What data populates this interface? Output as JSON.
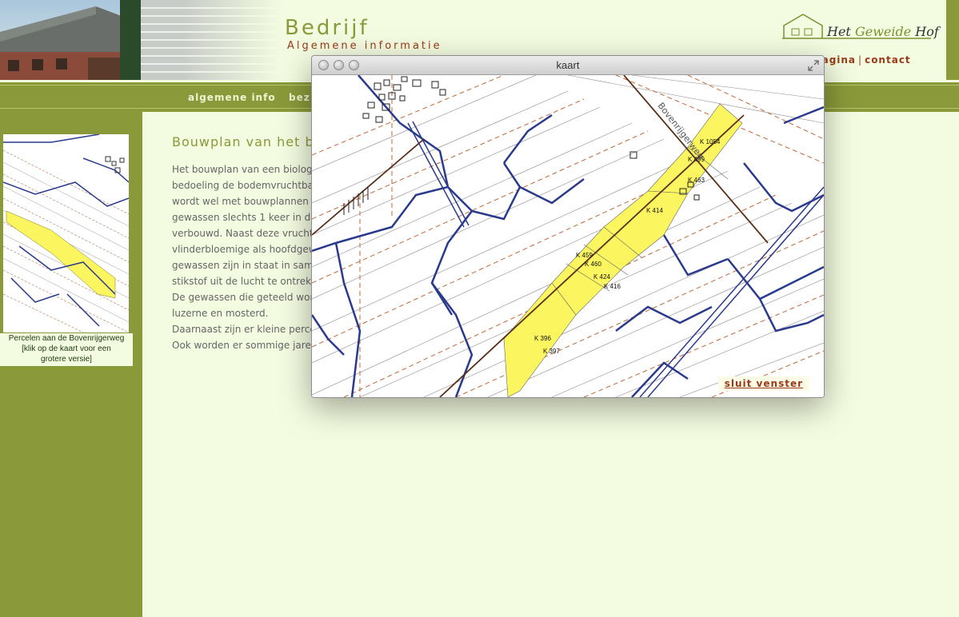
{
  "header": {
    "title": "Bedrijf",
    "subtitle": "Algemene informatie",
    "logo": {
      "text_left": "Het ",
      "text_mid": "Geweide",
      "text_right": " Hof"
    },
    "links": {
      "link1": "pagina",
      "link2": "contact"
    }
  },
  "nav": {
    "items": [
      "algemene info",
      "bez"
    ]
  },
  "sidebar": {
    "caption": [
      "Percelen aan de Bovenrijgerweg",
      "[klik op de kaart voor een",
      "grotere versie]"
    ]
  },
  "content": {
    "title": "Bouwplan van het b",
    "lines": [
      "Het bouwplan van een biologi",
      "bedoeling de bodemvruchtbaa",
      "wordt wel met bouwplannen",
      "gewassen slechts 1 keer in de",
      "verbouwd. Naast deze vrucht",
      "vlinderbloemige als hoofdgew",
      "gewassen zijn in staat in sam",
      "stikstof uit de lucht te ontrek",
      "De gewassen die geteeld word",
      "luzerne en mosterd.",
      "Daarnaast zijn er kleine perce",
      "Ook worden er sommige jarer"
    ]
  },
  "popup": {
    "title": "kaart",
    "close_label": "sluit venster",
    "parcels": [
      "K 1054",
      "K 499",
      "K 463",
      "K 414",
      "K 459",
      "K 460",
      "K 424",
      "K 416",
      "K 396",
      "K 397"
    ],
    "street_label": "Bovenrijgerweg"
  },
  "colors": {
    "olive": "#8a9a3a",
    "cream": "#f3fbe0",
    "rust": "#9a3a18",
    "parcel_yellow": "#fbf55f",
    "map_blue": "#2a3a8c"
  }
}
